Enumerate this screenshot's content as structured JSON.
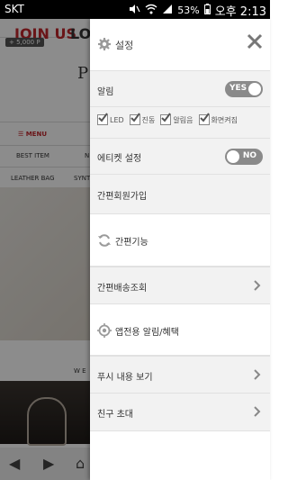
{
  "status": {
    "carrier": "SKT",
    "battery": "53%",
    "time": "오후 2:13"
  },
  "background": {
    "join_label": "JOIN US",
    "login_label": "LOGI",
    "points": "+ 5,000 P",
    "logo_fragment": "P",
    "menu_label": "MENU",
    "cat_best": "BEST ITEM",
    "cat_n": "N",
    "cat_leather": "LEATHER BAG",
    "cat_synt": "SYNT",
    "section_fragment": "W E"
  },
  "drawer": {
    "title": "설정",
    "alarm": {
      "label": "알림",
      "toggle": "YES",
      "on": true
    },
    "checks": [
      {
        "label": "LED",
        "checked": true
      },
      {
        "label": "진동",
        "checked": true
      },
      {
        "label": "알림음",
        "checked": true
      },
      {
        "label": "화면켜짐",
        "checked": true
      }
    ],
    "etiquette": {
      "label": "에티켓 설정",
      "toggle": "NO",
      "on": false
    },
    "simple_join": "간편회원가입",
    "simple_function": "간편기능",
    "simple_delivery": "간편배송조회",
    "app_alert": "앱전용 알림/혜택",
    "push_view": "푸시 내용 보기",
    "invite": "친구 초대"
  }
}
